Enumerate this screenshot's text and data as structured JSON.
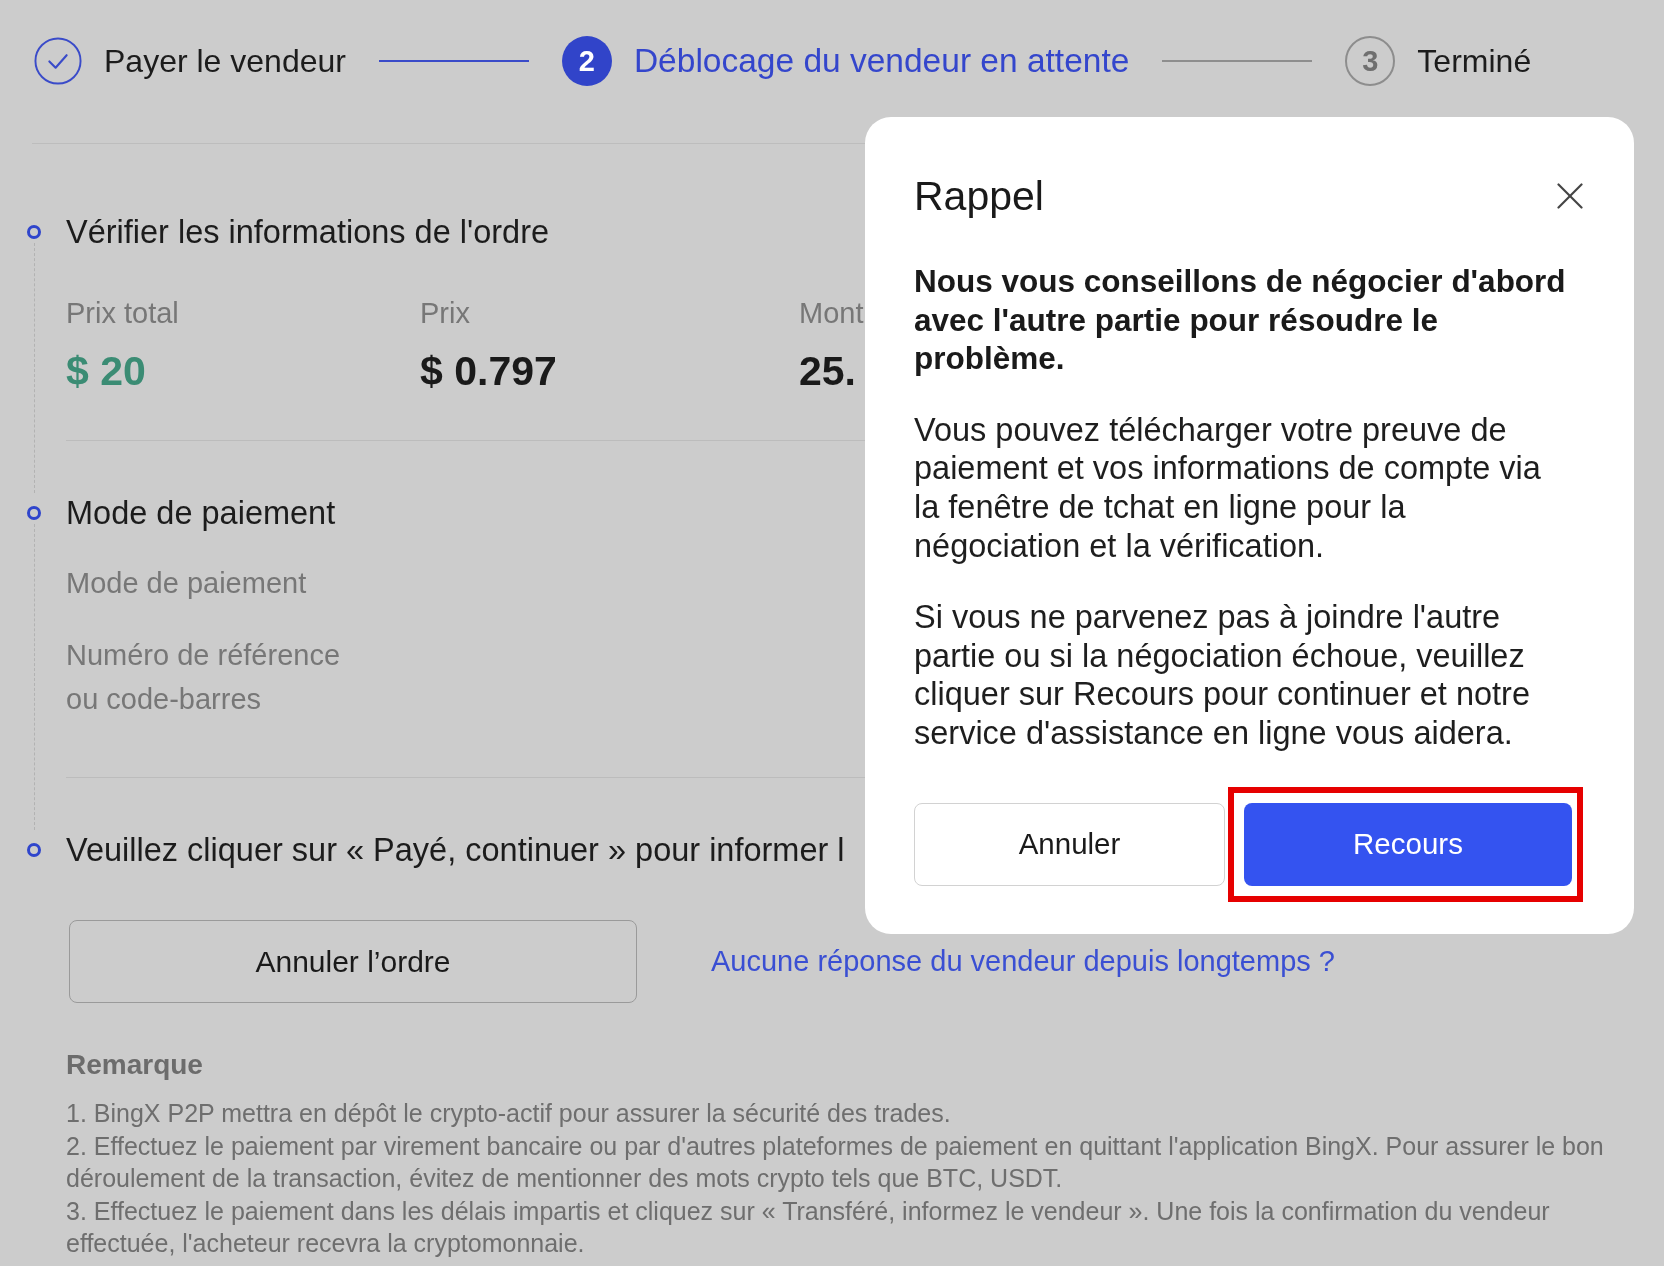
{
  "stepper": {
    "steps": [
      {
        "label": "Payer le vendeur",
        "kind": "done"
      },
      {
        "label": "Déblocage du vendeur en attente",
        "kind": "current",
        "number": "2"
      },
      {
        "label": "Terminé",
        "kind": "pending",
        "number": "3"
      }
    ]
  },
  "order_steps": [
    {
      "heading": "Vérifier les informations de l'ordre",
      "fields": [
        {
          "label": "Prix total",
          "value": "$ 20",
          "kind": "total"
        },
        {
          "label": "Prix",
          "value": "$ 0.797",
          "kind": "plain"
        },
        {
          "label": "Mont",
          "value": "25.",
          "kind": "plain"
        }
      ]
    },
    {
      "heading": "Mode de paiement",
      "details": [
        {
          "label": "Mode de paiement"
        },
        {
          "label": "Numéro de référence ou code-barres"
        }
      ]
    },
    {
      "heading": "Veuillez cliquer sur « Payé, continuer » pour informer l"
    }
  ],
  "actions": {
    "cancel_button": "Annuler l’ordre",
    "help_link": "Aucune réponse du vendeur depuis longtemps ?"
  },
  "remarks": {
    "title": "Remarque",
    "items": [
      "1. BingX P2P mettra en dépôt le crypto-actif pour assurer la sécurité des trades.",
      "2. Effectuez le paiement par virement bancaire ou par d'autres plateformes de paiement en quittant l'application BingX. Pour assurer le bon déroulement de la transaction, évitez de mentionner des mots crypto tels que BTC, USDT.",
      "3. Effectuez le paiement dans les délais impartis et cliquez sur « Transféré, informez le vendeur ». Une fois la confirmation du vendeur effectuée, l'acheteur recevra la cryptomonnaie."
    ]
  },
  "dialog": {
    "title": "Rappel",
    "notice": "Nous vous conseillons de négocier d'abord avec l'autre partie pour résoudre le problème.",
    "paragraphs": [
      "Vous pouvez télécharger votre preuve de paiement et vos informations de compte via la fenêtre de tchat en ligne pour la négociation et la vérification.",
      "Si vous ne parvenez pas à joindre l'autre partie ou si la négociation échoue, veuillez cliquer sur Recours pour continuer et notre service d'assistance en ligne vous aidera."
    ],
    "buttons": [
      {
        "label": "Annuler",
        "kind": "secondary",
        "highlighted": false
      },
      {
        "label": "Recours",
        "kind": "primary",
        "highlighted": true
      }
    ]
  }
}
